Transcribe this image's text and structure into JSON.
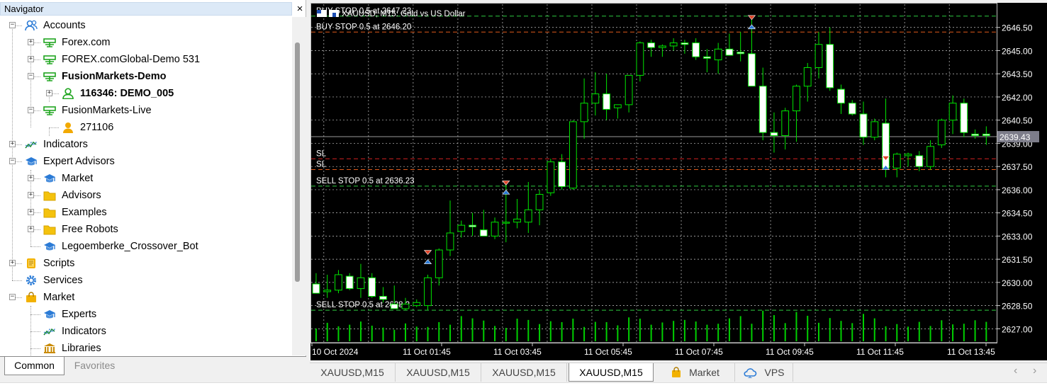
{
  "navigator": {
    "title": "Navigator",
    "close_symbol": "×",
    "items": [
      {
        "label": "Accounts",
        "icon": "accounts-icon",
        "expander": "−",
        "bold": false
      },
      {
        "label": "Forex.com",
        "icon": "broker-server-icon",
        "expander": "+",
        "bold": false
      },
      {
        "label": "FOREX.comGlobal-Demo 531",
        "icon": "broker-server-icon",
        "expander": "+",
        "bold": false
      },
      {
        "label": "FusionMarkets-Demo",
        "icon": "broker-server-icon",
        "expander": "−",
        "bold": true
      },
      {
        "label": "116346: DEMO_005",
        "icon": "user-green-icon",
        "expander": "+",
        "bold": true
      },
      {
        "label": "FusionMarkets-Live",
        "icon": "broker-server-icon",
        "expander": "−",
        "bold": false
      },
      {
        "label": "271106",
        "icon": "user-orange-icon",
        "expander": "",
        "bold": false
      },
      {
        "label": "Indicators",
        "icon": "indicator-icon",
        "expander": "+",
        "bold": false
      },
      {
        "label": "Expert Advisors",
        "icon": "graduation-cap-icon",
        "expander": "−",
        "bold": false
      },
      {
        "label": "Market",
        "icon": "graduation-cap-icon",
        "expander": "+",
        "bold": false
      },
      {
        "label": "Advisors",
        "icon": "folder-icon",
        "expander": "+",
        "bold": false
      },
      {
        "label": "Examples",
        "icon": "folder-icon",
        "expander": "+",
        "bold": false
      },
      {
        "label": "Free Robots",
        "icon": "folder-icon",
        "expander": "+",
        "bold": false
      },
      {
        "label": "Legoemberke_Crossover_Bot",
        "icon": "graduation-cap-icon",
        "expander": "",
        "bold": false
      },
      {
        "label": "Scripts",
        "icon": "script-icon",
        "expander": "+",
        "bold": false
      },
      {
        "label": "Services",
        "icon": "services-gear-icon",
        "expander": "",
        "bold": false
      },
      {
        "label": "Market",
        "icon": "market-bag-icon",
        "expander": "−",
        "bold": false
      },
      {
        "label": "Experts",
        "icon": "graduation-cap-icon",
        "expander": "",
        "bold": false
      },
      {
        "label": "Indicators",
        "icon": "indicator-icon",
        "expander": "",
        "bold": false
      },
      {
        "label": "Libraries",
        "icon": "library-icon",
        "expander": "",
        "bold": false
      }
    ],
    "tabs": {
      "common": "Common",
      "favorites": "Favorites"
    }
  },
  "chart": {
    "symbol_line": "XAUUSD, M15:  Gold vs US Dollar",
    "price_levels": [
      2646.5,
      2645.0,
      2643.5,
      2642.0,
      2640.5,
      2639.0,
      2637.5,
      2636.0,
      2634.5,
      2633.0,
      2631.5,
      2630.0,
      2628.5,
      2627.0
    ],
    "price_labels": [
      "2646.50",
      "2645.00",
      "2643.50",
      "2642.00",
      "2640.50",
      "2639.00",
      "2637.50",
      "2636.00",
      "2634.50",
      "2633.00",
      "2631.50",
      "2630.00",
      "2628.50",
      "2627.00"
    ],
    "current_price": "2639.43",
    "time_labels": [
      "10 Oct 2024",
      "11 Oct 01:45",
      "11 Oct 03:45",
      "11 Oct 05:45",
      "11 Oct 07:45",
      "11 Oct 09:45",
      "11 Oct 11:45",
      "11 Oct 13:45"
    ],
    "order_lines": [
      {
        "label": "BUY STOP 0.5 at 2647.23",
        "price": 2647.23,
        "color": "#2ecc40"
      },
      {
        "label": "BUY STOP 0.5 at 2646.20",
        "price": 2646.2,
        "color": "#e05a1a"
      },
      {
        "label": "SL",
        "price": 2638.0,
        "color": "#d42020"
      },
      {
        "label": "SL",
        "price": 2637.3,
        "color": "#e05a1a"
      },
      {
        "label": "SELL STOP 0.5 at 2636.23",
        "price": 2636.23,
        "color": "#2ecc40"
      },
      {
        "label": "SELL STOP 0.5 at 2628.2",
        "price": 2628.2,
        "color": "#2ecc40"
      }
    ],
    "bid_price": 2639.43,
    "colors": {
      "background": "#000000",
      "bull": "#000000",
      "bear": "#ffffff",
      "wick": "#00e600",
      "grid": "#c8c8c8",
      "volume": "#00d000",
      "text": "#ffffff"
    }
  },
  "chart_data": {
    "type": "candlestick",
    "title": "XAUUSD, M15:  Gold vs US Dollar",
    "ylim": [
      2626.1,
      2648.0
    ],
    "candles": [
      [
        2629.9,
        2630.6,
        2629.4,
        2629.3
      ],
      [
        2629.4,
        2630.5,
        2629.0,
        2629.5
      ],
      [
        2629.5,
        2630.8,
        2629.3,
        2630.5
      ],
      [
        2630.4,
        2630.6,
        2629.5,
        2629.6
      ],
      [
        2629.6,
        2631.2,
        2629.0,
        2630.3
      ],
      [
        2630.3,
        2630.6,
        2629.0,
        2629.1
      ],
      [
        2629.1,
        2629.7,
        2628.7,
        2628.9
      ],
      [
        2628.6,
        2629.8,
        2628.3,
        2628.3
      ],
      [
        2628.3,
        2629.0,
        2628.2,
        2628.6
      ],
      [
        2628.5,
        2628.9,
        2628.4,
        2628.7
      ],
      [
        2628.5,
        2630.5,
        2628.2,
        2630.3
      ],
      [
        2630.3,
        2632.2,
        2629.8,
        2632.1
      ],
      [
        2632.1,
        2635.3,
        2631.7,
        2633.2
      ],
      [
        2633.3,
        2634.0,
        2632.9,
        2633.7
      ],
      [
        2633.7,
        2634.5,
        2633.0,
        2633.6
      ],
      [
        2633.4,
        2634.7,
        2633.1,
        2633.0
      ],
      [
        2633.0,
        2634.2,
        2632.8,
        2633.9
      ],
      [
        2633.9,
        2636.3,
        2632.6,
        2633.9
      ],
      [
        2633.9,
        2635.4,
        2633.5,
        2634.1
      ],
      [
        2633.9,
        2636.5,
        2633.2,
        2634.7
      ],
      [
        2634.7,
        2636.0,
        2633.7,
        2635.7
      ],
      [
        2635.8,
        2638.0,
        2635.6,
        2637.8
      ],
      [
        2637.8,
        2638.3,
        2636.0,
        2636.2
      ],
      [
        2636.1,
        2640.5,
        2636.0,
        2640.4
      ],
      [
        2640.4,
        2643.2,
        2639.3,
        2641.6
      ],
      [
        2641.6,
        2643.6,
        2640.8,
        2642.2
      ],
      [
        2642.2,
        2643.5,
        2640.5,
        2641.2
      ],
      [
        2641.3,
        2641.4,
        2640.6,
        2641.5
      ],
      [
        2641.5,
        2643.4,
        2641.0,
        2643.4
      ],
      [
        2643.4,
        2645.6,
        2643.0,
        2645.5
      ],
      [
        2645.5,
        2645.7,
        2644.6,
        2645.2
      ],
      [
        2645.2,
        2645.4,
        2644.6,
        2645.3
      ],
      [
        2645.3,
        2645.8,
        2645.0,
        2645.5
      ],
      [
        2645.5,
        2645.7,
        2644.8,
        2645.4
      ],
      [
        2645.5,
        2645.8,
        2644.4,
        2644.6
      ],
      [
        2644.6,
        2645.1,
        2643.6,
        2644.5
      ],
      [
        2644.4,
        2645.5,
        2643.5,
        2645.1
      ],
      [
        2645.1,
        2646.1,
        2644.8,
        2644.7
      ],
      [
        2644.9,
        2646.2,
        2644.3,
        2644.8
      ],
      [
        2644.8,
        2647.0,
        2644.0,
        2642.7
      ],
      [
        2642.7,
        2643.9,
        2639.2,
        2639.7
      ],
      [
        2639.7,
        2641.0,
        2638.4,
        2639.5
      ],
      [
        2639.5,
        2641.3,
        2638.6,
        2641.1
      ],
      [
        2641.1,
        2642.8,
        2639.1,
        2642.7
      ],
      [
        2642.7,
        2644.2,
        2641.7,
        2643.9
      ],
      [
        2643.9,
        2646.2,
        2643.2,
        2645.4
      ],
      [
        2645.4,
        2646.5,
        2642.4,
        2642.6
      ],
      [
        2642.5,
        2642.8,
        2640.9,
        2641.6
      ],
      [
        2641.6,
        2641.8,
        2640.8,
        2640.9
      ],
      [
        2640.9,
        2641.7,
        2638.9,
        2639.4
      ],
      [
        2639.4,
        2640.6,
        2639.2,
        2640.4
      ],
      [
        2640.3,
        2641.9,
        2636.8,
        2637.4
      ],
      [
        2637.4,
        2638.4,
        2636.8,
        2638.3
      ],
      [
        2638.2,
        2638.4,
        2637.5,
        2638.3
      ],
      [
        2638.2,
        2638.5,
        2637.2,
        2637.5
      ],
      [
        2637.5,
        2639.2,
        2637.3,
        2638.8
      ],
      [
        2638.9,
        2640.6,
        2638.7,
        2640.5
      ],
      [
        2640.5,
        2642.1,
        2639.6,
        2641.6
      ],
      [
        2641.6,
        2641.9,
        2639.4,
        2639.7
      ],
      [
        2639.6,
        2639.9,
        2639.3,
        2639.5
      ],
      [
        2639.6,
        2640.1,
        2638.9,
        2639.5
      ]
    ],
    "volumes": [
      40,
      58,
      47,
      52,
      62,
      49,
      43,
      36,
      56,
      46,
      45,
      60,
      52,
      79,
      72,
      65,
      48,
      42,
      71,
      67,
      54,
      63,
      60,
      71,
      45,
      61,
      60,
      50,
      75,
      71,
      52,
      59,
      64,
      67,
      62,
      52,
      55,
      72,
      79,
      55,
      96,
      82,
      57,
      92,
      80,
      58,
      73,
      64,
      57,
      86,
      72,
      47,
      54,
      46,
      61,
      48,
      66,
      53,
      55,
      66,
      61
    ],
    "annotations": [
      "BUY STOP 0.5 at 2647.23",
      "BUY STOP 0.5 at 2646.20",
      "SL",
      "SL",
      "SELL STOP 0.5 at 2636.23",
      "SELL STOP 0.5 at 2628.2"
    ]
  },
  "chart_tabs": [
    {
      "label": "XAUUSD,M15",
      "icon": "",
      "active": false
    },
    {
      "label": "XAUUSD,M15",
      "icon": "",
      "active": false
    },
    {
      "label": "XAUUSD,M15",
      "icon": "",
      "active": false
    },
    {
      "label": "XAUUSD,M15",
      "icon": "",
      "active": true
    },
    {
      "label": "Market",
      "icon": "market-bag-icon",
      "active": false
    },
    {
      "label": "VPS",
      "icon": "cloud-icon",
      "active": false
    }
  ],
  "scroll_arrows": {
    "left": "‹",
    "right": "›"
  }
}
